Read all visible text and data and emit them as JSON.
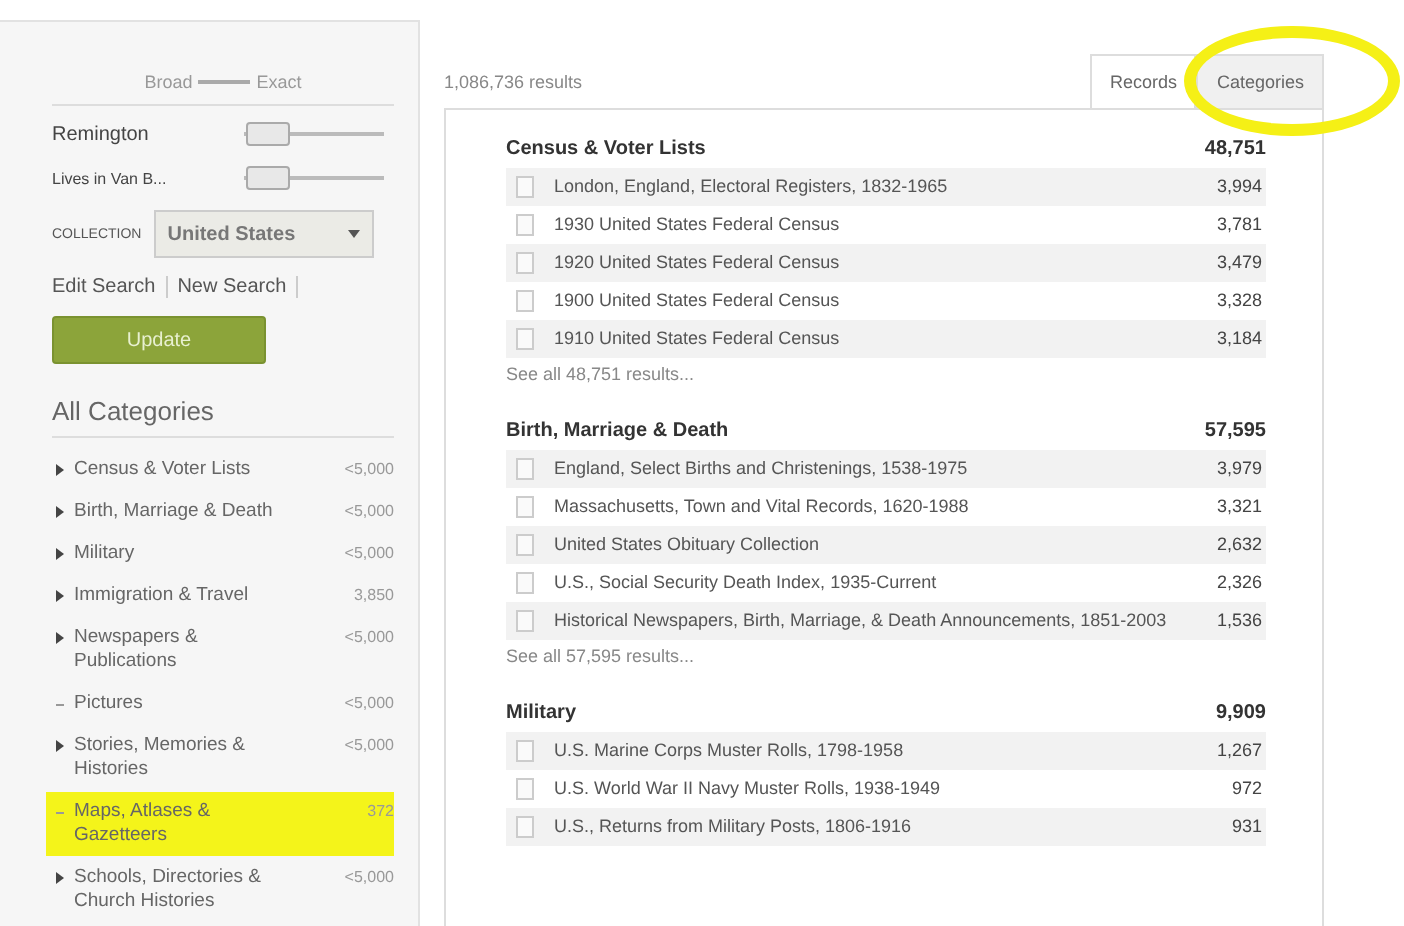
{
  "sidebar": {
    "match_scale": {
      "broad": "Broad",
      "exact": "Exact"
    },
    "terms": [
      {
        "label": "Remington",
        "level": 0.15
      },
      {
        "label": "Lives in Van B...",
        "level": 0.15
      }
    ],
    "collection": {
      "label": "COLLECTION",
      "value": "United States"
    },
    "links": [
      "Edit Search",
      "New Search"
    ],
    "update_button": "Update",
    "categories_title": "All Categories",
    "categories": [
      {
        "name": "Census & Voter Lists",
        "count": "<5,000",
        "expandable": true,
        "highlighted": false
      },
      {
        "name": "Birth, Marriage & Death",
        "count": "<5,000",
        "expandable": true,
        "highlighted": false
      },
      {
        "name": "Military",
        "count": "<5,000",
        "expandable": true,
        "highlighted": false
      },
      {
        "name": "Immigration & Travel",
        "count": "3,850",
        "expandable": true,
        "highlighted": false
      },
      {
        "name": "Newspapers & Publications",
        "count": "<5,000",
        "expandable": true,
        "highlighted": false
      },
      {
        "name": "Pictures",
        "count": "<5,000",
        "expandable": false,
        "highlighted": false
      },
      {
        "name": "Stories, Memories & Histories",
        "count": "<5,000",
        "expandable": true,
        "highlighted": false
      },
      {
        "name": "Maps, Atlases & Gazetteers",
        "count": "372",
        "expandable": false,
        "highlighted": true
      },
      {
        "name": "Schools, Directories & Church Histories",
        "count": "<5,000",
        "expandable": true,
        "highlighted": false
      }
    ]
  },
  "results_count": "1,086,736 results",
  "tabs": [
    {
      "label": "Records",
      "selected": true,
      "circled": false
    },
    {
      "label": "Categories",
      "selected": false,
      "circled": true
    }
  ],
  "sections": [
    {
      "title": "Census & Voter Lists",
      "count": "48,751",
      "see_all": "See all 48,751 results...",
      "rows": [
        {
          "name": "London, England, Electoral Registers, 1832-1965",
          "count": "3,994"
        },
        {
          "name": "1930 United States Federal Census",
          "count": "3,781"
        },
        {
          "name": "1920 United States Federal Census",
          "count": "3,479"
        },
        {
          "name": "1900 United States Federal Census",
          "count": "3,328"
        },
        {
          "name": "1910 United States Federal Census",
          "count": "3,184"
        }
      ]
    },
    {
      "title": "Birth, Marriage & Death",
      "count": "57,595",
      "see_all": "See all 57,595 results...",
      "rows": [
        {
          "name": "England, Select Births and Christenings, 1538-1975",
          "count": "3,979"
        },
        {
          "name": "Massachusetts, Town and Vital Records, 1620-1988",
          "count": "3,321"
        },
        {
          "name": "United States Obituary Collection",
          "count": "2,632"
        },
        {
          "name": "U.S., Social Security Death Index, 1935-Current",
          "count": "2,326"
        },
        {
          "name": "Historical Newspapers, Birth, Marriage, & Death Announcements, 1851-2003",
          "count": "1,536"
        }
      ]
    },
    {
      "title": "Military",
      "count": "9,909",
      "rows": [
        {
          "name": "U.S. Marine Corps Muster Rolls, 1798-1958",
          "count": "1,267"
        },
        {
          "name": "U.S. World War II Navy Muster Rolls, 1938-1949",
          "count": "972"
        },
        {
          "name": "U.S., Returns from Military Posts, 1806-1916",
          "count": "931"
        }
      ]
    }
  ]
}
